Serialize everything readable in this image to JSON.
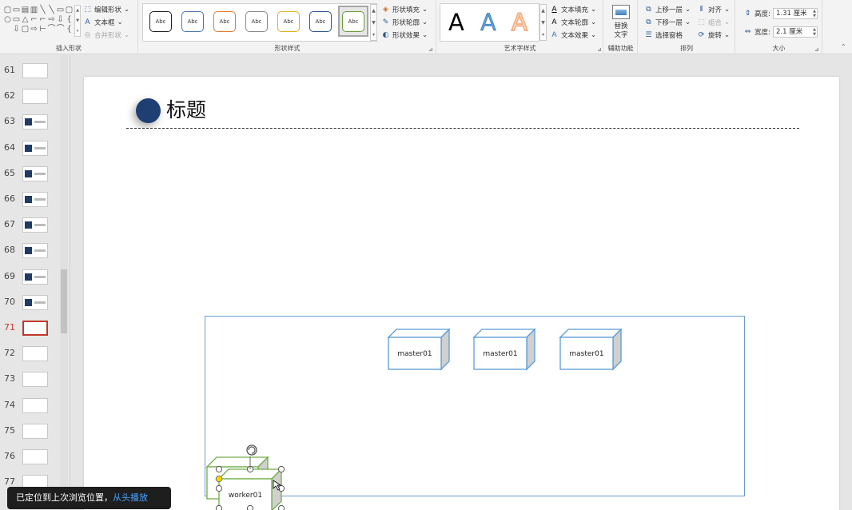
{
  "ribbon": {
    "insert_shapes": {
      "label": "插入形状",
      "edit_shape": "编辑形状",
      "text_box": "文本框",
      "merge_shapes": "合并形状",
      "shape_glyphs": [
        "▢",
        "▭",
        "▤",
        "▥",
        "╲",
        "╲",
        "▭",
        "▢",
        "○",
        "▭",
        "△",
        "⌐",
        "⌐",
        "⇨",
        "⇩",
        "{",
        " ",
        "⇩",
        "▢",
        "⇨",
        "⊢",
        "⌒",
        "⌒",
        "{"
      ]
    },
    "shape_styles": {
      "label": "形状样式",
      "thumbs": [
        {
          "text": "Abc",
          "border": "#222"
        },
        {
          "text": "Abc",
          "border": "#4a78b5"
        },
        {
          "text": "Abc",
          "border": "#e07b39"
        },
        {
          "text": "Abc",
          "border": "#8a8a8a"
        },
        {
          "text": "Abc",
          "border": "#e0b020"
        },
        {
          "text": "Abc",
          "border": "#2f5597"
        },
        {
          "text": "Abc",
          "border": "#6a9a3a"
        }
      ],
      "fill": "形状填充",
      "outline": "形状轮廓",
      "effects": "形状效果"
    },
    "wordart": {
      "label": "艺术字样式",
      "samples": [
        {
          "text": "A",
          "color": "#000000"
        },
        {
          "text": "A",
          "color": "#5b9bd5"
        },
        {
          "text": "A",
          "color": "#f4b183"
        }
      ],
      "text_fill": "文本填充",
      "text_outline": "文本轮廓",
      "text_effects": "文本效果"
    },
    "accessibility": {
      "label": "辅助功能",
      "alt_text_line1": "替换",
      "alt_text_line2": "文字"
    },
    "arrange": {
      "label": "排列",
      "bring_forward": "上移一层",
      "send_backward": "下移一层",
      "selection_pane": "选择窗格",
      "align": "对齐",
      "group": "组合",
      "rotate": "旋转"
    },
    "size": {
      "label": "大小",
      "height_label": "高度:",
      "height_value": "1.31 厘米",
      "width_label": "宽度:",
      "width_value": "2.1 厘米"
    }
  },
  "thumbnails": [
    {
      "num": "61",
      "style": "light"
    },
    {
      "num": "62",
      "style": "light"
    },
    {
      "num": "63",
      "style": "dark"
    },
    {
      "num": "64",
      "style": "dark"
    },
    {
      "num": "65",
      "style": "dark"
    },
    {
      "num": "66",
      "style": "dark"
    },
    {
      "num": "67",
      "style": "dark"
    },
    {
      "num": "68",
      "style": "dark"
    },
    {
      "num": "69",
      "style": "dark"
    },
    {
      "num": "70",
      "style": "dark"
    },
    {
      "num": "71",
      "style": "light",
      "active": true
    },
    {
      "num": "72",
      "style": "light"
    },
    {
      "num": "73",
      "style": "light"
    },
    {
      "num": "74",
      "style": "light"
    },
    {
      "num": "75",
      "style": "light"
    },
    {
      "num": "76",
      "style": "light"
    },
    {
      "num": "77",
      "style": "light"
    }
  ],
  "slide": {
    "title": "标题",
    "masters": [
      "master01",
      "master01",
      "master01"
    ],
    "worker": "worker01",
    "accent": "#1f3f73",
    "frame_color": "#6c9bd2",
    "cube_color": "#5b9bd5",
    "worker_color": "#70ad47"
  },
  "toast": {
    "message": "已定位到上次浏览位置，",
    "link": "从头播放"
  }
}
